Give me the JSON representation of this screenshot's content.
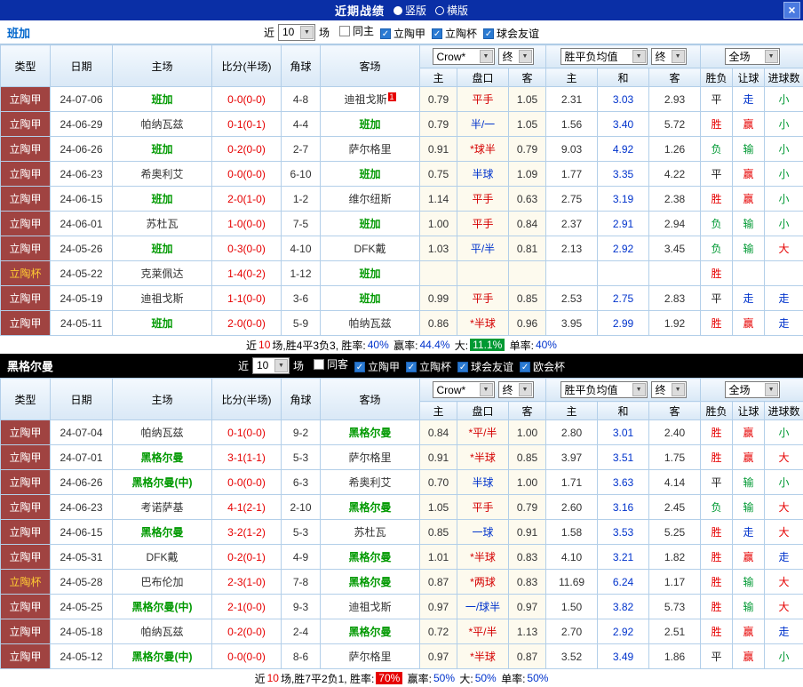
{
  "titlebar": {
    "title": "近期战绩",
    "close_icon": "×",
    "options": [
      {
        "label": "竖版",
        "selected": true
      },
      {
        "label": "横版",
        "selected": false
      }
    ]
  },
  "headers": {
    "type": "类型",
    "date": "日期",
    "home": "主场",
    "score": "比分(半场)",
    "corner": "角球",
    "away": "客场",
    "ah_home": "主",
    "handicap": "盘口",
    "ah_away": "客",
    "eu_home": "主",
    "eu_draw": "和",
    "eu_away": "客",
    "result": "胜负",
    "let": "让球",
    "goals": "进球数"
  },
  "colors": {
    "win": "#e60000",
    "draw": "#222222",
    "lose": "#009933",
    "let_win": "#e60000",
    "let_lose": "#009933",
    "let_walk": "#0033cc",
    "goal_big": "#e60000",
    "goal_small": "#009933",
    "goal_walk": "#0033cc",
    "handicap_red": "#d40000",
    "handicap_blue": "#0033cc",
    "eu_draw": "#0033cc",
    "focus_team": "#009900",
    "score": "#e60000",
    "league_bg": "#a04341",
    "cup_text": "#ffcc33",
    "titlebar_bg": "#0a2fa6"
  },
  "sections": [
    {
      "team": "班加",
      "filters": {
        "near_label": "近",
        "count": "10",
        "unit_label": "场",
        "checkboxes": [
          {
            "label": "同主",
            "checked": false
          },
          {
            "label": "立陶甲",
            "checked": true
          },
          {
            "label": "立陶杯",
            "checked": true
          },
          {
            "label": "球会友谊",
            "checked": true
          }
        ]
      },
      "selects": {
        "company": "Crow*",
        "company_final": "终",
        "europe": "胜平负均值",
        "europe_final": "终",
        "scope": "全场"
      },
      "rows": [
        {
          "league": "立陶甲",
          "cup": false,
          "date": "24-07-06",
          "home": "班加",
          "home_focus": true,
          "score": "0-0(0-0)",
          "corner": "4-8",
          "away": "迪祖戈斯",
          "away_focus": false,
          "away_badge": "1",
          "ah_home": "0.79",
          "handicap": "平手",
          "handicap_color": "red",
          "ah_away": "1.05",
          "eu_home": "2.31",
          "eu_draw": "3.03",
          "eu_away": "2.93",
          "result": "平",
          "handicap_result": "走",
          "goals_result": "小"
        },
        {
          "league": "立陶甲",
          "cup": false,
          "date": "24-06-29",
          "home": "帕纳瓦兹",
          "home_focus": false,
          "score": "0-1(0-1)",
          "corner": "4-4",
          "away": "班加",
          "away_focus": true,
          "away_badge": "",
          "ah_home": "0.79",
          "handicap": "半/一",
          "handicap_color": "blue",
          "ah_away": "1.05",
          "eu_home": "1.56",
          "eu_draw": "3.40",
          "eu_away": "5.72",
          "result": "胜",
          "handicap_result": "赢",
          "goals_result": "小"
        },
        {
          "league": "立陶甲",
          "cup": false,
          "date": "24-06-26",
          "home": "班加",
          "home_focus": true,
          "score": "0-2(0-0)",
          "corner": "2-7",
          "away": "萨尔格里",
          "away_focus": false,
          "away_badge": "",
          "ah_home": "0.91",
          "handicap": "*球半",
          "handicap_color": "red",
          "ah_away": "0.79",
          "eu_home": "9.03",
          "eu_draw": "4.92",
          "eu_away": "1.26",
          "result": "负",
          "handicap_result": "输",
          "goals_result": "小"
        },
        {
          "league": "立陶甲",
          "cup": false,
          "date": "24-06-23",
          "home": "希奥利艾",
          "home_focus": false,
          "score": "0-0(0-0)",
          "corner": "6-10",
          "away": "班加",
          "away_focus": true,
          "away_badge": "",
          "ah_home": "0.75",
          "handicap": "半球",
          "handicap_color": "blue",
          "ah_away": "1.09",
          "eu_home": "1.77",
          "eu_draw": "3.35",
          "eu_away": "4.22",
          "result": "平",
          "handicap_result": "赢",
          "goals_result": "小"
        },
        {
          "league": "立陶甲",
          "cup": false,
          "date": "24-06-15",
          "home": "班加",
          "home_focus": true,
          "score": "2-0(1-0)",
          "corner": "1-2",
          "away": "维尔纽斯",
          "away_focus": false,
          "away_badge": "",
          "ah_home": "1.14",
          "handicap": "平手",
          "handicap_color": "red",
          "ah_away": "0.63",
          "eu_home": "2.75",
          "eu_draw": "3.19",
          "eu_away": "2.38",
          "result": "胜",
          "handicap_result": "赢",
          "goals_result": "小"
        },
        {
          "league": "立陶甲",
          "cup": false,
          "date": "24-06-01",
          "home": "苏杜瓦",
          "home_focus": false,
          "score": "1-0(0-0)",
          "corner": "7-5",
          "away": "班加",
          "away_focus": true,
          "away_badge": "",
          "ah_home": "1.00",
          "handicap": "平手",
          "handicap_color": "red",
          "ah_away": "0.84",
          "eu_home": "2.37",
          "eu_draw": "2.91",
          "eu_away": "2.94",
          "result": "负",
          "handicap_result": "输",
          "goals_result": "小"
        },
        {
          "league": "立陶甲",
          "cup": false,
          "date": "24-05-26",
          "home": "班加",
          "home_focus": true,
          "score": "0-3(0-0)",
          "corner": "4-10",
          "away": "DFK戴",
          "away_focus": false,
          "away_badge": "",
          "ah_home": "1.03",
          "handicap": "平/半",
          "handicap_color": "blue",
          "ah_away": "0.81",
          "eu_home": "2.13",
          "eu_draw": "2.92",
          "eu_away": "3.45",
          "result": "负",
          "handicap_result": "输",
          "goals_result": "大"
        },
        {
          "league": "立陶杯",
          "cup": true,
          "date": "24-05-22",
          "home": "克莱佩达",
          "home_focus": false,
          "score": "1-4(0-2)",
          "corner": "1-12",
          "away": "班加",
          "away_focus": true,
          "away_badge": "",
          "ah_home": "",
          "handicap": "",
          "handicap_color": "",
          "ah_away": "",
          "eu_home": "",
          "eu_draw": "",
          "eu_away": "",
          "result": "胜",
          "handicap_result": "",
          "goals_result": ""
        },
        {
          "league": "立陶甲",
          "cup": false,
          "date": "24-05-19",
          "home": "迪祖戈斯",
          "home_focus": false,
          "score": "1-1(0-0)",
          "corner": "3-6",
          "away": "班加",
          "away_focus": true,
          "away_badge": "",
          "ah_home": "0.99",
          "handicap": "平手",
          "handicap_color": "red",
          "ah_away": "0.85",
          "eu_home": "2.53",
          "eu_draw": "2.75",
          "eu_away": "2.83",
          "result": "平",
          "handicap_result": "走",
          "goals_result": "走"
        },
        {
          "league": "立陶甲",
          "cup": false,
          "date": "24-05-11",
          "home": "班加",
          "home_focus": true,
          "score": "2-0(0-0)",
          "corner": "5-9",
          "away": "帕纳瓦兹",
          "away_focus": false,
          "away_badge": "",
          "ah_home": "0.86",
          "handicap": "*半球",
          "handicap_color": "red",
          "ah_away": "0.96",
          "eu_home": "3.95",
          "eu_draw": "2.99",
          "eu_away": "1.92",
          "result": "胜",
          "handicap_result": "赢",
          "goals_result": "走"
        }
      ],
      "summary": [
        {
          "text": "近"
        },
        {
          "text": "10",
          "color": "#e60000"
        },
        {
          "text": "场,胜4平3负3, 胜率:"
        },
        {
          "text": "40%",
          "color": "#0033cc"
        },
        {
          "text": " 赢率:"
        },
        {
          "text": "44.4%",
          "color": "#0033cc"
        },
        {
          "text": " 大:"
        },
        {
          "text": "11.1%",
          "color": "#ffffff",
          "bg": "#009933"
        },
        {
          "text": " 单率:"
        },
        {
          "text": "40%",
          "color": "#0033cc"
        }
      ]
    },
    {
      "team": "黑格尔曼",
      "filters": {
        "near_label": "近",
        "count": "10",
        "unit_label": "场",
        "checkboxes": [
          {
            "label": "同客",
            "checked": false
          },
          {
            "label": "立陶甲",
            "checked": true
          },
          {
            "label": "立陶杯",
            "checked": true
          },
          {
            "label": "球会友谊",
            "checked": true
          },
          {
            "label": "欧会杯",
            "checked": true
          }
        ]
      },
      "selects": {
        "company": "Crow*",
        "company_final": "终",
        "europe": "胜平负均值",
        "europe_final": "终",
        "scope": "全场"
      },
      "rows": [
        {
          "league": "立陶甲",
          "cup": false,
          "date": "24-07-04",
          "home": "帕纳瓦兹",
          "home_focus": false,
          "score": "0-1(0-0)",
          "corner": "9-2",
          "away": "黑格尔曼",
          "away_focus": true,
          "away_badge": "",
          "ah_home": "0.84",
          "handicap": "*平/半",
          "handicap_color": "red",
          "ah_away": "1.00",
          "eu_home": "2.80",
          "eu_draw": "3.01",
          "eu_away": "2.40",
          "result": "胜",
          "handicap_result": "赢",
          "goals_result": "小"
        },
        {
          "league": "立陶甲",
          "cup": false,
          "date": "24-07-01",
          "home": "黑格尔曼",
          "home_focus": true,
          "score": "3-1(1-1)",
          "corner": "5-3",
          "away": "萨尔格里",
          "away_focus": false,
          "away_badge": "",
          "ah_home": "0.91",
          "handicap": "*半球",
          "handicap_color": "red",
          "ah_away": "0.85",
          "eu_home": "3.97",
          "eu_draw": "3.51",
          "eu_away": "1.75",
          "result": "胜",
          "handicap_result": "赢",
          "goals_result": "大"
        },
        {
          "league": "立陶甲",
          "cup": false,
          "date": "24-06-26",
          "home": "黑格尔曼(中)",
          "home_focus": true,
          "score": "0-0(0-0)",
          "corner": "6-3",
          "away": "希奥利艾",
          "away_focus": false,
          "away_badge": "",
          "ah_home": "0.70",
          "handicap": "半球",
          "handicap_color": "blue",
          "ah_away": "1.00",
          "eu_home": "1.71",
          "eu_draw": "3.63",
          "eu_away": "4.14",
          "result": "平",
          "handicap_result": "输",
          "goals_result": "小"
        },
        {
          "league": "立陶甲",
          "cup": false,
          "date": "24-06-23",
          "home": "考诺萨基",
          "home_focus": false,
          "score": "4-1(2-1)",
          "corner": "2-10",
          "away": "黑格尔曼",
          "away_focus": true,
          "away_badge": "",
          "ah_home": "1.05",
          "handicap": "平手",
          "handicap_color": "red",
          "ah_away": "0.79",
          "eu_home": "2.60",
          "eu_draw": "3.16",
          "eu_away": "2.45",
          "result": "负",
          "handicap_result": "输",
          "goals_result": "大"
        },
        {
          "league": "立陶甲",
          "cup": false,
          "date": "24-06-15",
          "home": "黑格尔曼",
          "home_focus": true,
          "score": "3-2(1-2)",
          "corner": "5-3",
          "away": "苏杜瓦",
          "away_focus": false,
          "away_badge": "",
          "ah_home": "0.85",
          "handicap": "一球",
          "handicap_color": "blue",
          "ah_away": "0.91",
          "eu_home": "1.58",
          "eu_draw": "3.53",
          "eu_away": "5.25",
          "result": "胜",
          "handicap_result": "走",
          "goals_result": "大"
        },
        {
          "league": "立陶甲",
          "cup": false,
          "date": "24-05-31",
          "home": "DFK戴",
          "home_focus": false,
          "score": "0-2(0-1)",
          "corner": "4-9",
          "away": "黑格尔曼",
          "away_focus": true,
          "away_badge": "",
          "ah_home": "1.01",
          "handicap": "*半球",
          "handicap_color": "red",
          "ah_away": "0.83",
          "eu_home": "4.10",
          "eu_draw": "3.21",
          "eu_away": "1.82",
          "result": "胜",
          "handicap_result": "赢",
          "goals_result": "走"
        },
        {
          "league": "立陶杯",
          "cup": true,
          "date": "24-05-28",
          "home": "巴布伦加",
          "home_focus": false,
          "score": "2-3(1-0)",
          "corner": "7-8",
          "away": "黑格尔曼",
          "away_focus": true,
          "away_badge": "",
          "ah_home": "0.87",
          "handicap": "*两球",
          "handicap_color": "red",
          "ah_away": "0.83",
          "eu_home": "11.69",
          "eu_draw": "6.24",
          "eu_away": "1.17",
          "result": "胜",
          "handicap_result": "输",
          "goals_result": "大"
        },
        {
          "league": "立陶甲",
          "cup": false,
          "date": "24-05-25",
          "home": "黑格尔曼(中)",
          "home_focus": true,
          "score": "2-1(0-0)",
          "corner": "9-3",
          "away": "迪祖戈斯",
          "away_focus": false,
          "away_badge": "",
          "ah_home": "0.97",
          "handicap": "一/球半",
          "handicap_color": "blue",
          "ah_away": "0.97",
          "eu_home": "1.50",
          "eu_draw": "3.82",
          "eu_away": "5.73",
          "result": "胜",
          "handicap_result": "输",
          "goals_result": "大"
        },
        {
          "league": "立陶甲",
          "cup": false,
          "date": "24-05-18",
          "home": "帕纳瓦兹",
          "home_focus": false,
          "score": "0-2(0-0)",
          "corner": "2-4",
          "away": "黑格尔曼",
          "away_focus": true,
          "away_badge": "",
          "ah_home": "0.72",
          "handicap": "*平/半",
          "handicap_color": "red",
          "ah_away": "1.13",
          "eu_home": "2.70",
          "eu_draw": "2.92",
          "eu_away": "2.51",
          "result": "胜",
          "handicap_result": "赢",
          "goals_result": "走"
        },
        {
          "league": "立陶甲",
          "cup": false,
          "date": "24-05-12",
          "home": "黑格尔曼(中)",
          "home_focus": true,
          "score": "0-0(0-0)",
          "corner": "8-6",
          "away": "萨尔格里",
          "away_focus": false,
          "away_badge": "",
          "ah_home": "0.97",
          "handicap": "*半球",
          "handicap_color": "red",
          "ah_away": "0.87",
          "eu_home": "3.52",
          "eu_draw": "3.49",
          "eu_away": "1.86",
          "result": "平",
          "handicap_result": "赢",
          "goals_result": "小"
        }
      ],
      "summary": [
        {
          "text": "近"
        },
        {
          "text": "10",
          "color": "#e60000"
        },
        {
          "text": "场,胜7平2负1, 胜率:"
        },
        {
          "text": "70%",
          "color": "#ffffff",
          "bg": "#e60000"
        },
        {
          "text": " 赢率:"
        },
        {
          "text": "50%",
          "color": "#0033cc"
        },
        {
          "text": " 大:"
        },
        {
          "text": "50%",
          "color": "#0033cc"
        },
        {
          "text": " 单率:"
        },
        {
          "text": "50%",
          "color": "#0033cc"
        }
      ]
    }
  ]
}
